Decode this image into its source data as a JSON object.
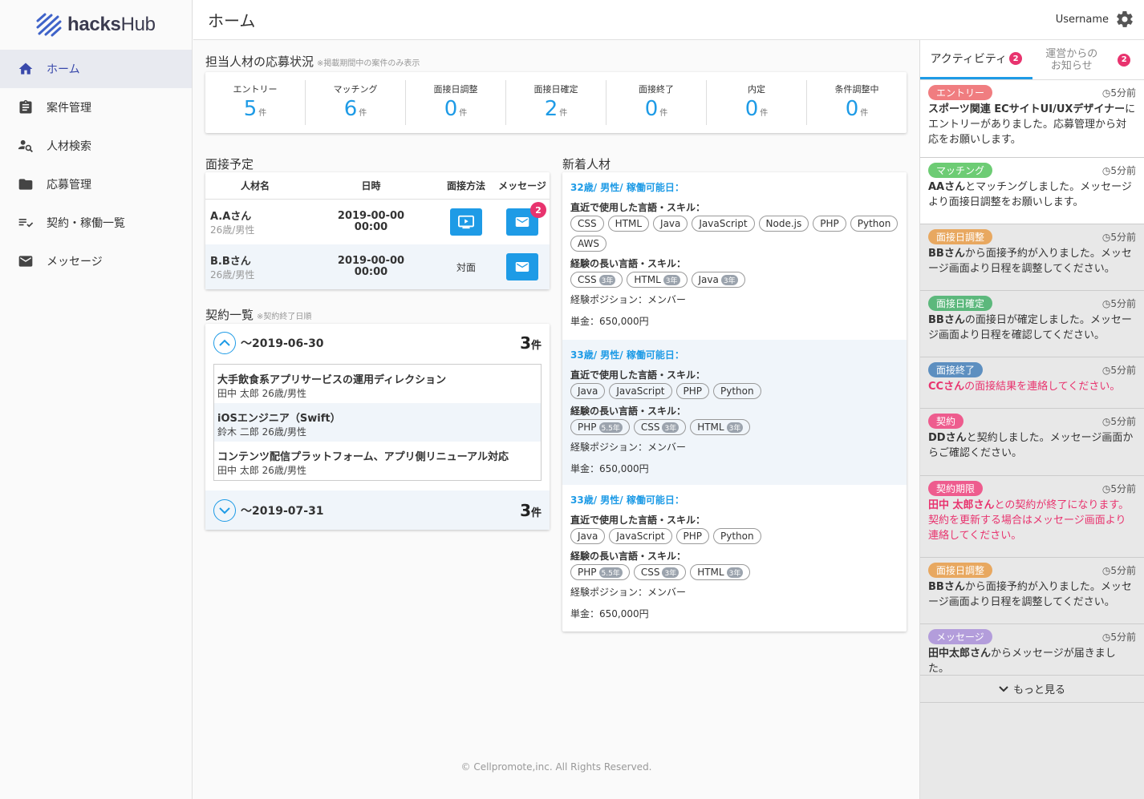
{
  "brand": {
    "name_bold": "hacks",
    "name_rest": "Hub"
  },
  "sidebar": {
    "items": [
      {
        "label": "ホーム",
        "icon": "home-icon"
      },
      {
        "label": "案件管理",
        "icon": "clipboard-icon"
      },
      {
        "label": "人材検索",
        "icon": "person-search-icon"
      },
      {
        "label": "応募管理",
        "icon": "folder-icon"
      },
      {
        "label": "契約・稼働一覧",
        "icon": "list-check-icon"
      },
      {
        "label": "メッセージ",
        "icon": "mail-icon"
      }
    ]
  },
  "header": {
    "title": "ホーム",
    "username": "Username"
  },
  "status": {
    "title": "担当人材の応募状況",
    "note": "※掲載期間中の案件のみ表示",
    "unit": "件",
    "items": [
      {
        "label": "エントリー",
        "value": "5"
      },
      {
        "label": "マッチング",
        "value": "6"
      },
      {
        "label": "面接日調整",
        "value": "0"
      },
      {
        "label": "面接日確定",
        "value": "2"
      },
      {
        "label": "面接終了",
        "value": "0"
      },
      {
        "label": "内定",
        "value": "0"
      },
      {
        "label": "条件調整中",
        "value": "0"
      }
    ]
  },
  "interview": {
    "title": "面接予定",
    "headers": [
      "人材名",
      "日時",
      "面接方法",
      "メッセージ"
    ],
    "rows": [
      {
        "name": "A.Aさん",
        "sub": "26歳/男性",
        "date": "2019-00-00",
        "time": "00:00",
        "method": "online",
        "badge": "2"
      },
      {
        "name": "B.Bさん",
        "sub": "26歳/男性",
        "date": "2019-00-00",
        "time": "00:00",
        "method_label": "対面"
      }
    ]
  },
  "contracts": {
    "title": "契約一覧",
    "note": "※契約終了日順",
    "unit": "件",
    "groups": [
      {
        "date": "〜2019-06-30",
        "count": "3"
      },
      {
        "date": "〜2019-07-31",
        "count": "3"
      }
    ],
    "items": [
      {
        "title": "大手飲食系アプリサービスの運用ディレクション",
        "sub": "田中 太郎 26歳/男性"
      },
      {
        "title": "iOSエンジニア（Swift）",
        "sub": "鈴木 二郎 26歳/男性"
      },
      {
        "title": "コンテンツ配信プラットフォーム、アプリ側リニューアル対応",
        "sub": "田中 太郎 26歳/男性"
      }
    ]
  },
  "talents": {
    "title": "新着人材",
    "recent_label": "直近で使用した言語・スキル：",
    "long_label": "経験の長い言語・スキル：",
    "list": [
      {
        "head": "32歳/ 男性/ 稼働可能日：",
        "recent": [
          "CSS",
          "HTML",
          "Java",
          "JavaScript",
          "Node.js",
          "PHP",
          "Python",
          "AWS"
        ],
        "long": [
          {
            "n": "CSS",
            "y": "3年"
          },
          {
            "n": "HTML",
            "y": "3年"
          },
          {
            "n": "Java",
            "y": "3年"
          }
        ],
        "position": "経験ポジション：メンバー",
        "price": "単金：650,000円"
      },
      {
        "head": "33歳/ 男性/ 稼働可能日：",
        "recent": [
          "Java",
          "JavaScript",
          "PHP",
          "Python"
        ],
        "long": [
          {
            "n": "PHP",
            "y": "5.5年"
          },
          {
            "n": "CSS",
            "y": "3年"
          },
          {
            "n": "HTML",
            "y": "3年"
          }
        ],
        "position": "経験ポジション：メンバー",
        "price": "単金：650,000円"
      },
      {
        "head": "33歳/ 男性/ 稼働可能日：",
        "recent": [
          "Java",
          "JavaScript",
          "PHP",
          "Python"
        ],
        "long": [
          {
            "n": "PHP",
            "y": "5.5年"
          },
          {
            "n": "CSS",
            "y": "3年"
          },
          {
            "n": "HTML",
            "y": "3年"
          }
        ],
        "position": "経験ポジション：メンバー",
        "price": "単金：650,000円"
      }
    ]
  },
  "activity": {
    "tabs": [
      {
        "label": "アクティビティ",
        "badge": "2"
      },
      {
        "label1": "運営からの",
        "label2": "お知らせ",
        "badge": "2"
      }
    ],
    "items": [
      {
        "tag": "エントリー",
        "color": "#f07d80",
        "ago": "5分前",
        "white": true,
        "bold": "スポーツ関連 ECサイトUI/UXデザイナー",
        "text": "にエントリーがありました。応募管理から対応をお願いします。"
      },
      {
        "tag": "マッチング",
        "color": "#6dcc74",
        "ago": "5分前",
        "white": true,
        "bold": "AAさん",
        "text": "とマッチングしました。メッセージより面接日調整をお願いします。"
      },
      {
        "tag": "面接日調整",
        "color": "#e8a860",
        "ago": "5分前",
        "bold": "BBさん",
        "text": "から面接予約が入りました。メッセージ画面より日程を調整してください。"
      },
      {
        "tag": "面接日確定",
        "color": "#5cb87c",
        "ago": "5分前",
        "bold": "BBさん",
        "text": "の面接日が確定しました。メッセージ画面より日程を確認してください。"
      },
      {
        "tag": "面接終了",
        "color": "#5d8fc0",
        "ago": "5分前",
        "red": true,
        "bold": "CCさん",
        "text": "の面接結果を連絡してください。"
      },
      {
        "tag": "契約",
        "color": "#ee5c8e",
        "ago": "5分前",
        "bold": "DDさん",
        "text": "と契約しました。メッセージ画面からご確認ください。"
      },
      {
        "tag": "契約期限",
        "color": "#ee5c8e",
        "ago": "5分前",
        "red": true,
        "bold": "田中 太郎さん",
        "text": "との契約が終了になります。契約を更新する場合はメッセージ画面より連絡してください。"
      },
      {
        "tag": "面接日調整",
        "color": "#e8a860",
        "ago": "5分前",
        "bold": "BBさん",
        "text": "から面接予約が入りました。メッセージ画面より日程を調整してください。"
      },
      {
        "tag": "メッセージ",
        "color": "#b39ddb",
        "ago": "5分前",
        "bold": "田中太郎さん",
        "text": "からメッセージが届きました。"
      }
    ],
    "more": "もっと見る"
  },
  "footer": "© Cellpromote,inc. All Rights Reserved."
}
